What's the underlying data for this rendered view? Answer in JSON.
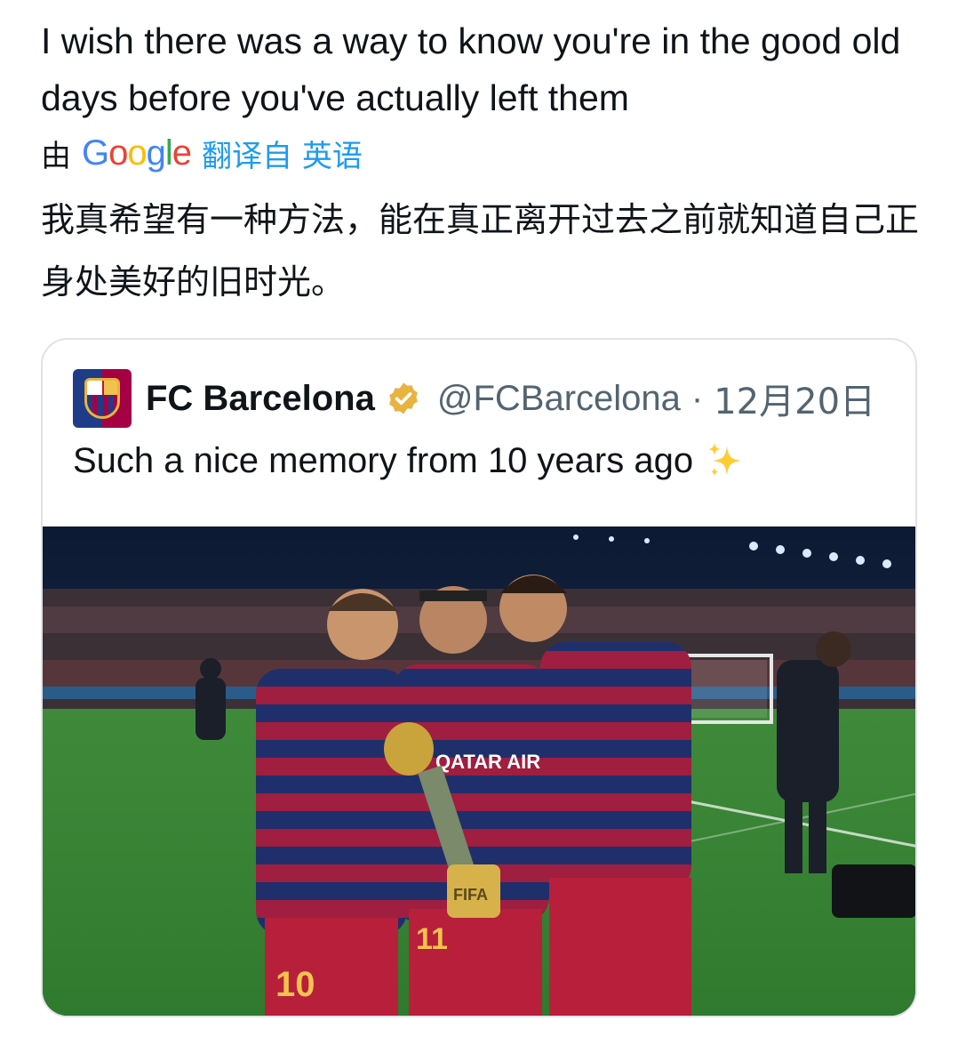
{
  "tweet": {
    "text": "I wish there was a way to know you're in the good old days before you've actually left them",
    "translation": {
      "prefix": "由",
      "provider": "Google",
      "suffix": "翻译自 英语",
      "text": "我真希望有一种方法，能在真正离开过去之前就知道自己正身处美好的旧时光。"
    }
  },
  "quoted_tweet": {
    "account_name": "FC Barcelona",
    "handle": "@FCBarcelona",
    "separator": "·",
    "date": "12月20日",
    "text": "Such a nice memory from 10 years ago",
    "emoji_icon": "sparkles-icon",
    "verified": true,
    "verified_color": "#e8b340",
    "photo": {
      "jersey_text": "QATAR AIRWAYS",
      "numbers": [
        "10",
        "11"
      ],
      "trophy_text": "FIFA"
    }
  },
  "colors": {
    "link": "#1d9bf0",
    "secondary_text": "#536471",
    "barca_blue": "#1f3c88",
    "barca_red": "#a50044"
  }
}
